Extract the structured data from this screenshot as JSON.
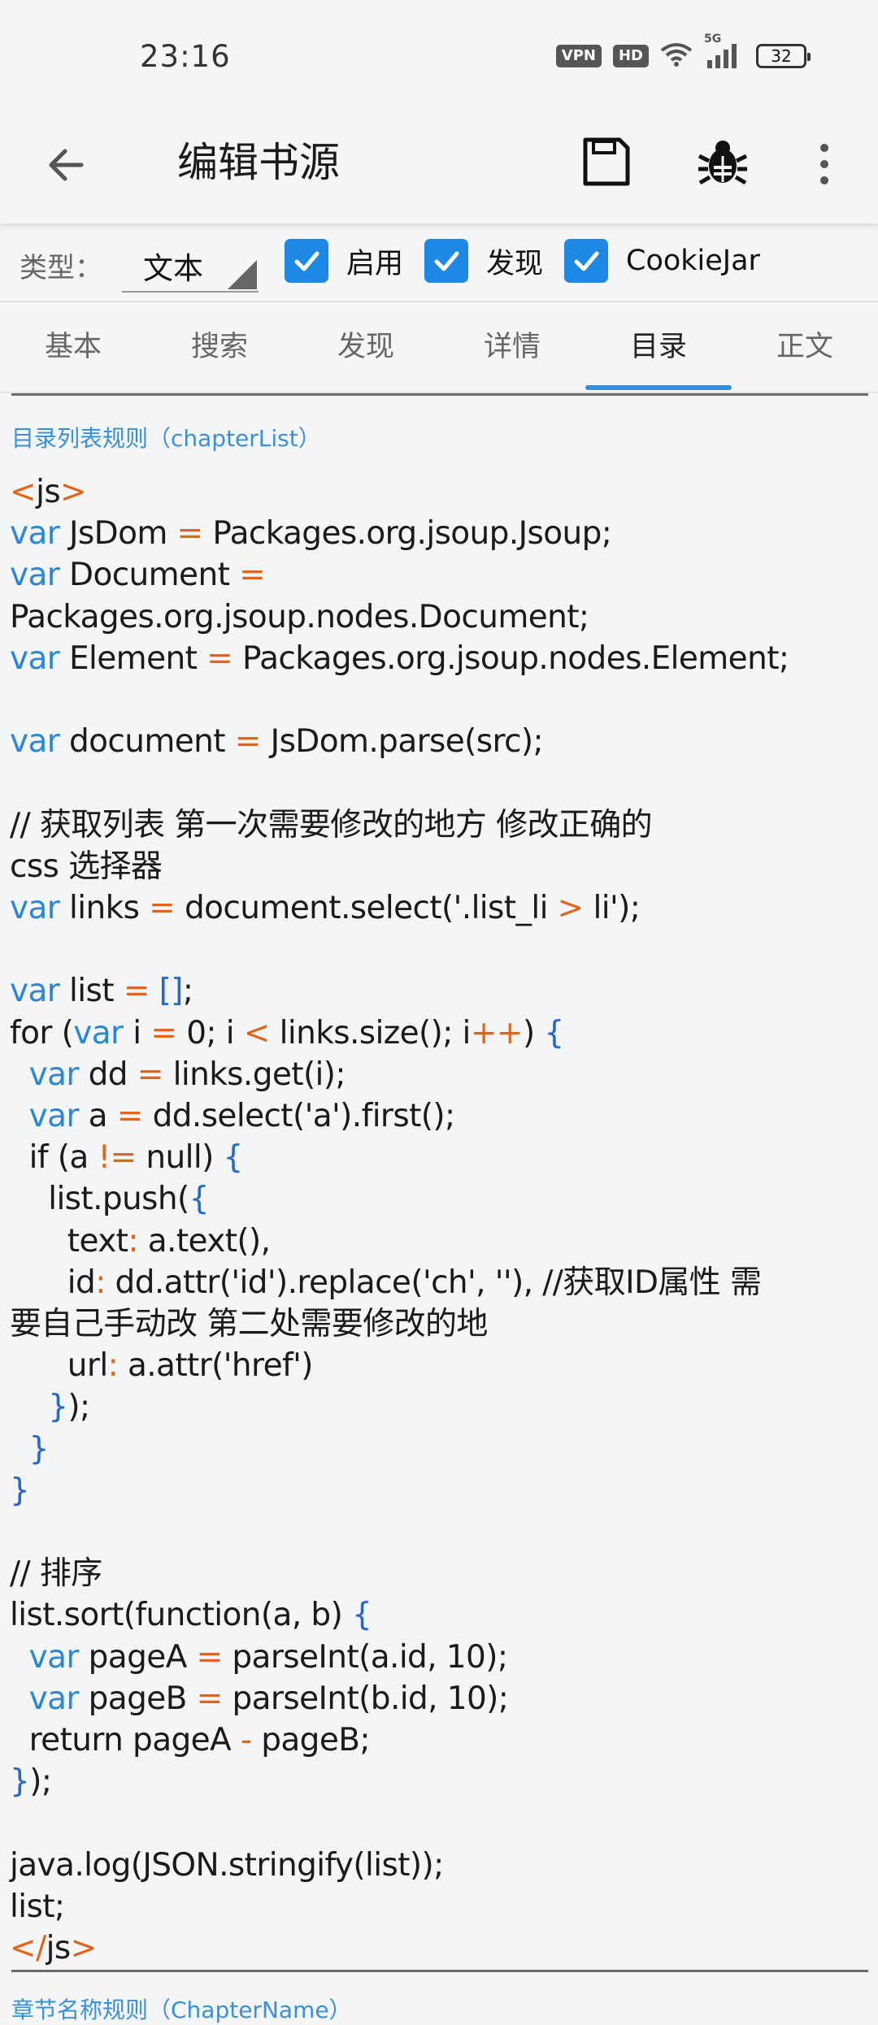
{
  "status_bar": {
    "time": "23:16",
    "vpn": "VPN",
    "hd": "HD",
    "network": "5G",
    "battery": "32"
  },
  "toolbar": {
    "title": "编辑书源",
    "icons": [
      "back-arrow-icon",
      "save-icon",
      "bug-icon",
      "more-vert-icon"
    ]
  },
  "options": {
    "type_label": "类型：",
    "type_value": "文本",
    "checkboxes": [
      {
        "label": "启用",
        "checked": true
      },
      {
        "label": "发现",
        "checked": true
      },
      {
        "label": "CookieJar",
        "checked": true
      }
    ],
    "accent": "#1e88e5"
  },
  "tabs": [
    {
      "label": "基本"
    },
    {
      "label": "搜索"
    },
    {
      "label": "发现"
    },
    {
      "label": "详情"
    },
    {
      "label": "目录",
      "active": true
    },
    {
      "label": "正文"
    }
  ],
  "editor": {
    "field_label": "目录列表规则（chapterList）",
    "code_lines": [
      "<js>",
      "var JsDom = Packages.org.jsoup.Jsoup;",
      "var Document =",
      "Packages.org.jsoup.nodes.Document;",
      "var Element = Packages.org.jsoup.nodes.Element;",
      "",
      "var document = JsDom.parse(src);",
      "",
      "// 获取列表 第一次需要修改的地方 修改正确的",
      "css 选择器",
      "var links = document.select('.list_li > li');",
      "",
      "var list = [];",
      "for (var i = 0; i < links.size(); i++) {",
      "  var dd = links.get(i);",
      "  var a = dd.select('a').first();",
      "  if (a != null) {",
      "    list.push({",
      "      text: a.text(),",
      "      id: dd.attr('id').replace('ch', ''), //获取ID属性 需",
      "要自己手动改 第二处需要修改的地",
      "      url: a.attr('href')",
      "    });",
      "  }",
      "}",
      "",
      "// 排序",
      "list.sort(function(a, b) {",
      "  var pageA = parseInt(a.id, 10);",
      "  var pageB = parseInt(b.id, 10);",
      "  return pageA - pageB;",
      "});",
      "",
      "java.log(JSON.stringify(list));",
      "list;",
      "</js>"
    ],
    "next_field_label": "章节名称规则（ChapterName）"
  }
}
